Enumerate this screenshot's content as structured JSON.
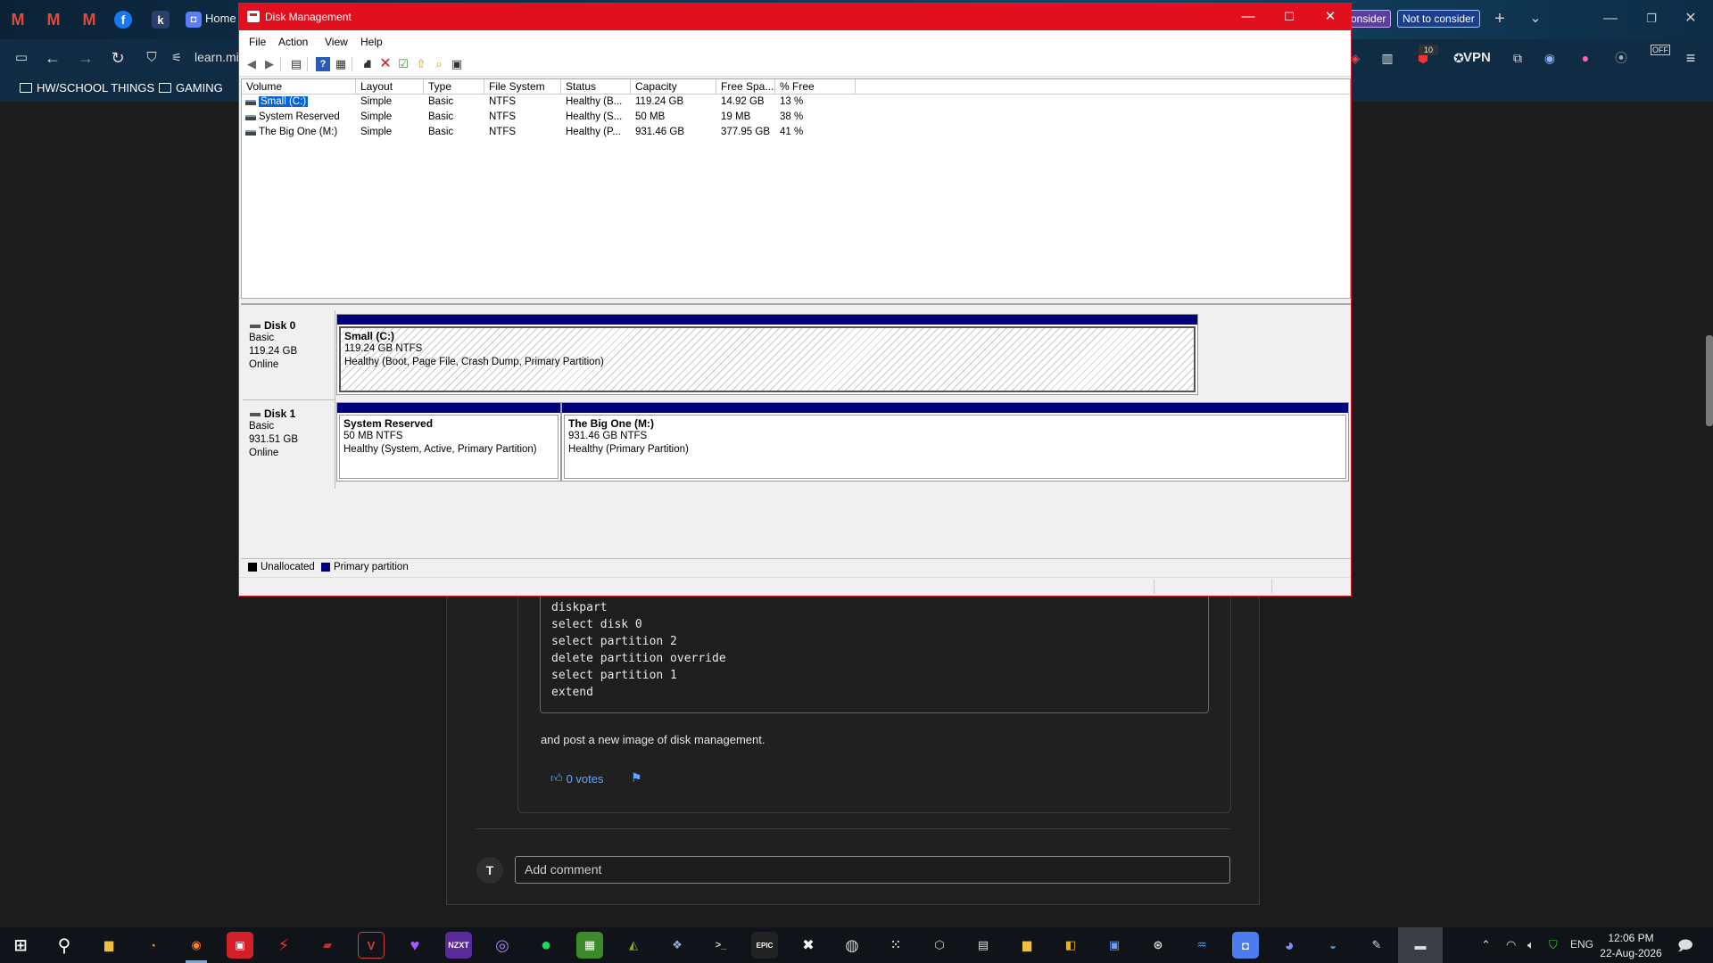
{
  "browser": {
    "tab_home": "Home",
    "tab_consider": "onsider",
    "tab_not_consider": "Not to consider",
    "url": "learn.mi",
    "vpn_label": "VPN",
    "ext_badge_count": "10",
    "off_label": "OFF",
    "bookmarks": [
      "HW/SCHOOL THINGS",
      "GAMING"
    ]
  },
  "page": {
    "code_lines": [
      "diskpart",
      "select disk 0",
      "select partition 2",
      "delete partition override",
      "select partition 1",
      "extend"
    ],
    "after_text": "and post a new image of disk management.",
    "votes": "0 votes",
    "avatar_letter": "T",
    "comment_placeholder": "Add comment"
  },
  "dm": {
    "title": "Disk Management",
    "menu": [
      "File",
      "Action",
      "View",
      "Help"
    ],
    "columns": [
      "Volume",
      "Layout",
      "Type",
      "File System",
      "Status",
      "Capacity",
      "Free Spa...",
      "% Free"
    ],
    "rows": [
      {
        "volume": "Small (C:)",
        "layout": "Simple",
        "type": "Basic",
        "fs": "NTFS",
        "status": "Healthy (B...",
        "capacity": "119.24 GB",
        "free": "14.92 GB",
        "pct": "13 %"
      },
      {
        "volume": "System Reserved",
        "layout": "Simple",
        "type": "Basic",
        "fs": "NTFS",
        "status": "Healthy (S...",
        "capacity": "50 MB",
        "free": "19 MB",
        "pct": "38 %"
      },
      {
        "volume": "The Big One (M:)",
        "layout": "Simple",
        "type": "Basic",
        "fs": "NTFS",
        "status": "Healthy (P...",
        "capacity": "931.46 GB",
        "free": "377.95 GB",
        "pct": "41 %"
      }
    ],
    "disks": [
      {
        "name": "Disk 0",
        "type": "Basic",
        "size": "119.24 GB",
        "state": "Online",
        "partitions": [
          {
            "name": "Small  (C:)",
            "size": "119.24 GB NTFS",
            "status": "Healthy (Boot, Page File, Crash Dump, Primary Partition)"
          }
        ]
      },
      {
        "name": "Disk 1",
        "type": "Basic",
        "size": "931.51 GB",
        "state": "Online",
        "partitions": [
          {
            "name": "System Reserved",
            "size": "50 MB NTFS",
            "status": "Healthy (System, Active, Primary Partition)"
          },
          {
            "name": "The Big One  (M:)",
            "size": "931.46 GB NTFS",
            "status": "Healthy (Primary Partition)"
          }
        ]
      }
    ],
    "legend": [
      "Unallocated",
      "Primary partition"
    ],
    "colors": {
      "unallocated": "#000000",
      "primary": "#00007c",
      "titlebar": "#e2101f"
    }
  },
  "taskbar": {
    "lang": "ENG",
    "time": "12:06 PM",
    "date": "22-Aug-2026"
  }
}
